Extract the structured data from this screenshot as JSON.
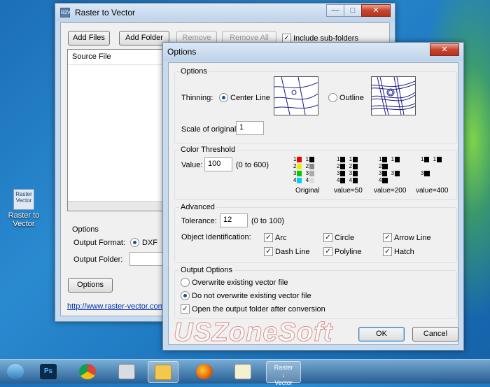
{
  "desktop": {
    "icon_label": "Raster to Vector",
    "icon_text": "Raster Vector"
  },
  "main": {
    "title": "Raster to Vector",
    "icon_text": "R2V",
    "buttons": {
      "add_files": "Add Files",
      "add_folder": "Add Folder",
      "remove": "Remove",
      "remove_all": "Remove All"
    },
    "include_subfolders": {
      "label": "Include sub-folders",
      "checked": true
    },
    "list_header": "Source File",
    "options_group": "Options",
    "output_format_label": "Output Format:",
    "output_format_value": "DXF",
    "output_folder_label": "Output Folder:",
    "output_folder_value": "",
    "options_button": "Options",
    "link": "http://www.raster-vector.com"
  },
  "dialog": {
    "title": "Options",
    "options_group": "Options",
    "thinning_label": "Thinning:",
    "thinning_center": "Center Line",
    "thinning_outline": "Outline",
    "thinning_selected": "Center Line",
    "scale_label": "Scale of original:",
    "scale_value": "1",
    "color_group": "Color Threshold",
    "value_label": "Value:",
    "value": "100",
    "value_range": "(0 to 600)",
    "threshold_captions": [
      "Original",
      "value=50",
      "value=200",
      "value=400"
    ],
    "advanced_group": "Advanced",
    "tolerance_label": "Tolerance:",
    "tolerance_value": "12",
    "tolerance_range": "(0 to 100)",
    "object_id_label": "Object Identification:",
    "objects": [
      {
        "label": "Arc",
        "checked": true
      },
      {
        "label": "Circle",
        "checked": true
      },
      {
        "label": "Arrow Line",
        "checked": true
      },
      {
        "label": "Dash Line",
        "checked": true
      },
      {
        "label": "Polyline",
        "checked": true
      },
      {
        "label": "Hatch",
        "checked": true
      }
    ],
    "output_group": "Output Options",
    "output_options": [
      {
        "label": "Overwrite existing vector file",
        "selected": false
      },
      {
        "label": "Do not overwrite existing vector file",
        "selected": true
      }
    ],
    "open_folder": {
      "label": "Open the output folder after conversion",
      "checked": true
    },
    "ok": "OK",
    "cancel": "Cancel"
  },
  "watermark": "USZoneSoft",
  "taskbar": {
    "ps": "Ps",
    "r2v_line1": "Raster",
    "r2v_line2": "Vector"
  },
  "colors": {
    "accent": "#1d4f91",
    "close": "#c6452e",
    "taskbar": "#2a5a8c"
  }
}
